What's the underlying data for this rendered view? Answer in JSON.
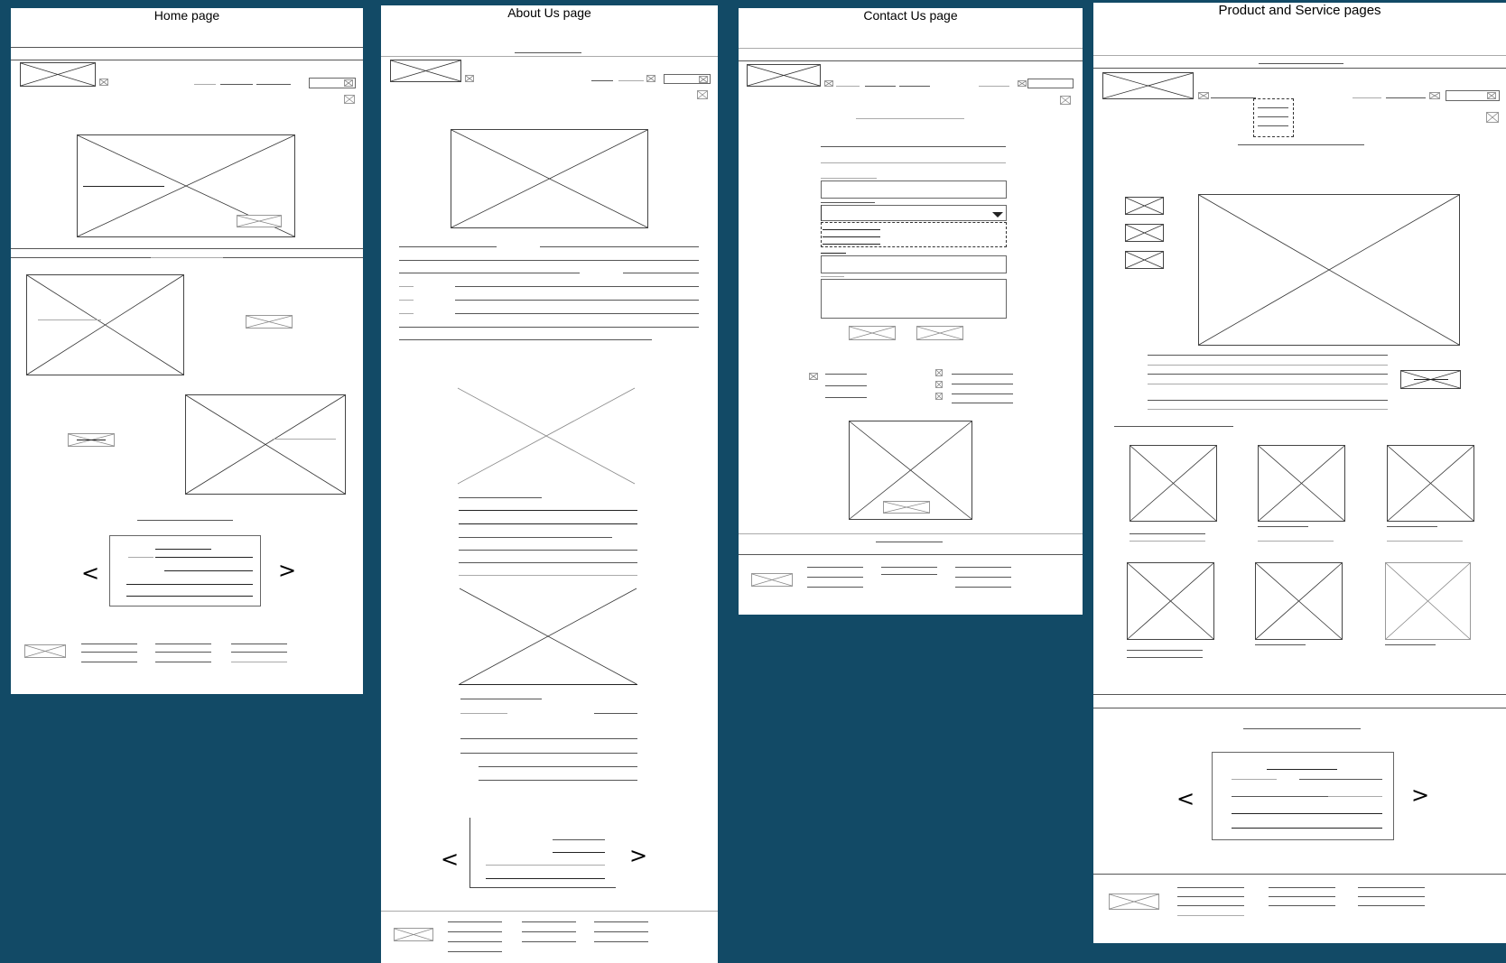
{
  "panels": {
    "home": {
      "title": "Home page"
    },
    "about": {
      "title": "About Us page"
    },
    "contact": {
      "title": "Contact Us page"
    },
    "product": {
      "title": "Product and Service pages"
    }
  },
  "glyphs": {
    "prev": "<",
    "next": ">"
  },
  "colors": {
    "background": "#124a66",
    "panel": "#ffffff"
  }
}
